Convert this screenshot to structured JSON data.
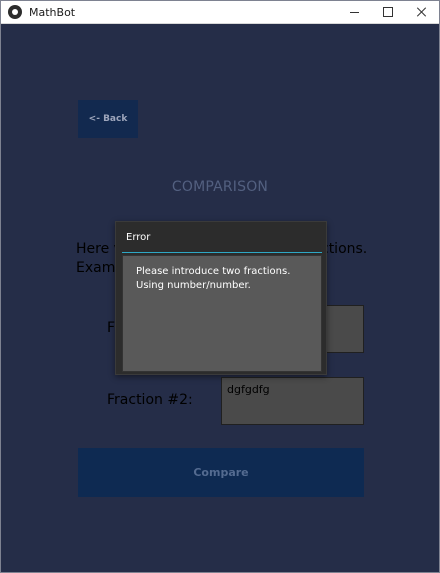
{
  "window": {
    "title": "MathBot",
    "controls": {
      "minimize": "minimize",
      "maximize": "maximize",
      "close": "close"
    }
  },
  "screen": {
    "back_label": "<- Back",
    "title": "COMPARISON",
    "instruction_left": "Here v\nExam",
    "instruction_right": "ctions.",
    "fraction1_label": "F",
    "fraction2_label": "Fraction #2:",
    "fraction1_value": "",
    "fraction2_value": "dgfgdfg",
    "compare_label": "Compare"
  },
  "dialog": {
    "title": "Error",
    "message_line_1": "Please introduce two fractions.",
    "message_line_2": "Using number/number."
  },
  "colors": {
    "background": "#252D48",
    "button": "#12294F",
    "dialog_accent": "#2EA8C5",
    "dialog_body": "#595959"
  },
  "icons": {
    "app": "mathbot-icon",
    "minimize": "minimize-icon",
    "maximize": "maximize-icon",
    "close": "close-icon"
  }
}
